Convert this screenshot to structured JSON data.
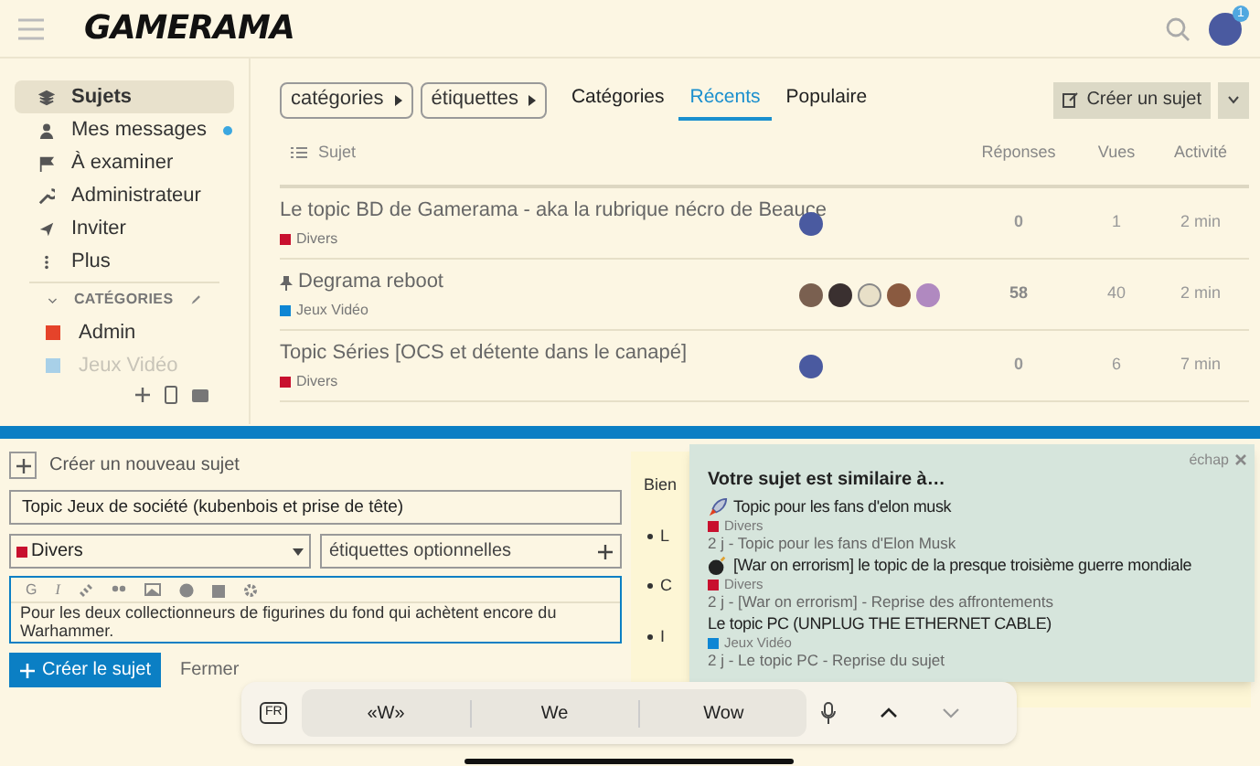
{
  "header": {
    "logo": "GAMERAMA",
    "notification_count": "1"
  },
  "sidebar": {
    "items": [
      {
        "label": "Sujets",
        "selected": true,
        "unread": false
      },
      {
        "label": "Mes messages",
        "selected": false,
        "unread": true
      },
      {
        "label": "À examiner",
        "selected": false,
        "unread": false
      },
      {
        "label": "Administrateur",
        "selected": false,
        "unread": false
      },
      {
        "label": "Inviter",
        "selected": false,
        "unread": false
      },
      {
        "label": "Plus",
        "selected": false,
        "unread": false
      }
    ],
    "categories_heading": "CATÉGORIES",
    "categories": [
      {
        "label": "Admin",
        "color": "#e5432a"
      },
      {
        "label": "Jeux Vidéo",
        "color": "#a8d0e8"
      }
    ]
  },
  "filters": [
    {
      "label": "catégories"
    },
    {
      "label": "étiquettes"
    }
  ],
  "tabs": [
    {
      "label": "Catégories",
      "selected": false
    },
    {
      "label": "Récents",
      "selected": true
    },
    {
      "label": "Populaire",
      "selected": false
    }
  ],
  "create_button": "Créer un sujet",
  "table": {
    "columns": [
      "Sujet",
      "Réponses",
      "Vues",
      "Activité"
    ],
    "rows": [
      {
        "title": "Le topic BD de Gamerama - aka la rubrique nécro de Beauce",
        "pinned": false,
        "category": "Divers",
        "color": "#c8102e",
        "replies": "0",
        "views": "1",
        "activity": "2 min",
        "hot": false
      },
      {
        "title": "Degrama reboot",
        "pinned": true,
        "category": "Jeux Vidéo",
        "color": "#0e86d4",
        "replies": "58",
        "views": "40",
        "activity": "2 min",
        "hot": true
      },
      {
        "title": "Topic Séries [OCS et détente dans le canapé]",
        "pinned": false,
        "category": "Divers",
        "color": "#c8102e",
        "replies": "0",
        "views": "6",
        "activity": "7 min",
        "hot": false
      }
    ]
  },
  "composer": {
    "action": "Créer un nouveau sujet",
    "title_value": "Topic Jeux de société (kubenbois et prise de tête)",
    "category": {
      "label": "Divers",
      "color": "#c8102e"
    },
    "tags_placeholder": "étiquettes optionnelles",
    "body": "Pour les deux collectionneurs de figurines du fond qui achètent encore du Warhammer.",
    "toolbar": [
      "G",
      "I"
    ],
    "submit": "Créer le sujet",
    "close": "Fermer",
    "preview": {
      "heading": "Bien",
      "bullets": [
        "L",
        "C",
        "I"
      ]
    }
  },
  "similar": {
    "dismiss": "échap",
    "title": "Votre sujet est similaire à…",
    "topics": [
      {
        "kind": "rocket",
        "title": "Topic pour les fans d'elon musk",
        "category": "Divers",
        "color": "#c8102e",
        "excerpt": "2 j - Topic pour les fans d'Elon Musk"
      },
      {
        "kind": "bomb",
        "title": "[War on errorism] le topic de la presque troisième guerre mondiale",
        "category": "Divers",
        "color": "#c8102e",
        "excerpt": "2 j - [War on errorism] - Reprise des affrontements"
      },
      {
        "kind": "plain",
        "title": "Le topic PC (UNPLUG THE ETHERNET CABLE)",
        "category": "Jeux Vidéo",
        "color": "#0e86d4",
        "excerpt": "2 j - Le topic PC - Reprise du sujet"
      }
    ]
  },
  "keyboard": {
    "language": "FR",
    "suggestions": [
      "«W»",
      "We",
      "Wow"
    ]
  }
}
